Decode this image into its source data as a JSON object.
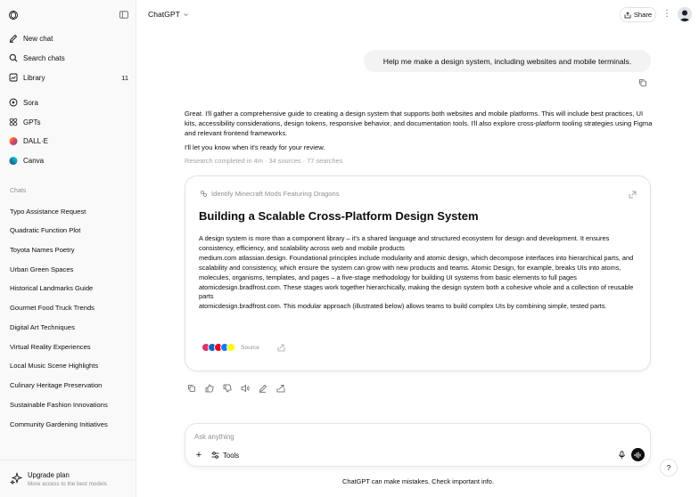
{
  "sidebar": {
    "top_items": [
      {
        "label": "New chat",
        "icon": "new-chat-icon"
      },
      {
        "label": "Search chats",
        "icon": "search-icon"
      },
      {
        "label": "Library",
        "icon": "library-icon",
        "count": "11"
      }
    ],
    "app_items": [
      {
        "label": "Sora",
        "icon": "sora-icon"
      },
      {
        "label": "GPTs",
        "icon": "gpts-icon"
      },
      {
        "label": "DALL·E",
        "icon": "dalle-icon"
      },
      {
        "label": "Canva",
        "icon": "canva-icon"
      }
    ],
    "section_label": "Chats",
    "chats": [
      "Typo Assistance Request",
      "Quadratic Function Plot",
      "Toyota Names Poetry",
      "Urban Green Spaces",
      "Historical Landmarks Guide",
      "Gourmet Food Truck Trends",
      "Digital Art Techniques",
      "Virtual Reality Experiences",
      "Local Music Scene Highlights",
      "Culinary Heritage Preservation",
      "Sustainable Fashion Innovations",
      "Community Gardening Initiatives"
    ],
    "upgrade": {
      "title": "Upgrade plan",
      "subtitle": "More access to the best models"
    }
  },
  "header": {
    "model_name": "ChatGPT",
    "share_label": "Share"
  },
  "conversation": {
    "user_message": "Help me make a design system, including websites and mobile terminals.",
    "assistant_intro": "Great. I'll gather a comprehensive guide to creating a design system that supports both websites and mobile platforms. This will include best practices, UI kits, accessibility considerations, design tokens, responsive behavior, and documentation tools. I'll also explore cross-platform tooling strategies using Figma and relevant frontend frameworks.",
    "assistant_followup": "I'll let you know when it's ready for your review.",
    "research_meta": "Research completed in 4m · 34 sources · 77 searches",
    "card": {
      "header": "Identify Minecraft Mods Featuring Dragons",
      "title": "Building a Scalable Cross-Platform Design System",
      "paragraphs": [
        "A design system is more than a component library – it's a shared language and structured ecosystem for design and development. It ensures consistency, efficiency, and scalability across web and mobile products",
        "medium.com atlassian.design. Foundational principles include modularity and atomic design, which decompose interfaces into hierarchical parts, and scalability and consistency, which ensure the system can grow with new products and teams. Atomic Design, for example, breaks UIs into atoms, molecules, organisms, templates, and pages – a five-stage methodology for building UI systems from basic elements to full pages",
        "atomicdesign.bradfrost.com. These stages work together hierarchically, making the design system both a cohesive whole and a collection of reusable parts",
        "atomicdesign.bradfrost.com. This modular approach (illustrated below) allows teams to build complex UIs by combining simple, tested parts."
      ],
      "source_label": "Source",
      "source_colors": [
        "#e1306c",
        "#0a66c2",
        "#e60023",
        "#1877f2",
        "#fffc00"
      ]
    }
  },
  "composer": {
    "placeholder": "Ask anything",
    "tools_label": "Tools"
  },
  "footer": {
    "disclaimer": "ChatGPT can make mistakes. Check important info.",
    "help_label": "?"
  }
}
